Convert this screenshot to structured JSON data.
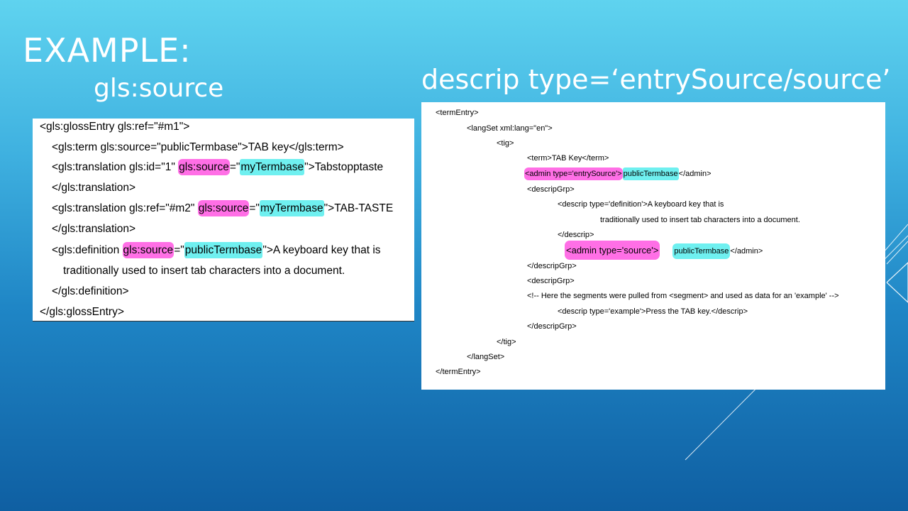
{
  "slide": {
    "title": "EXAMPLE:",
    "left_subtitle": "gls:source",
    "right_subtitle": "descrip type=‘entrySource/source’"
  },
  "left_code": {
    "l1": "<gls:glossEntry gls:ref=\"#m1\">",
    "l2": "<gls:term gls:source=\"publicTermbase\">TAB key</gls:term>",
    "l3a": "<gls:translation gls:id=\"1\" ",
    "l3b": "gls:source",
    "l3c": "=\"",
    "l3d": "myTermbase",
    "l3e": "\">Tabstopptaste",
    "l4": "</gls:translation>",
    "l5a": "<gls:translation gls:ref=\"#m2\" ",
    "l5b": "gls:source",
    "l5c": "=\"",
    "l5d": "myTermbase",
    "l5e": "\">TAB-TASTE",
    "l6": "</gls:translation>",
    "l7a": "<gls:definition ",
    "l7b": "gls:source",
    "l7c": "=\"",
    "l7d": "publicTermbase",
    "l7e": "\">A keyboard key that is",
    "l8": "traditionally used to insert tab characters into a document.",
    "l9": "</gls:definition>",
    "l10": "</gls:glossEntry>"
  },
  "right_code": {
    "r1": "<termEntry>",
    "r2": "<langSet xml:lang=\"en\">",
    "r3": "<tig>",
    "r4": "<term>TAB Key</term>",
    "r5a": "<admin type='entrySource'>",
    "r5b": "publicTermbase",
    "r5c": "</admin>",
    "r6": "<descripGrp>",
    "r7": "<descrip type='definition'>A keyboard key that is",
    "r8": "traditionally used to insert tab characters into a document.",
    "r9": "</descrip>",
    "r10a": "<admin type='source'>",
    "r10b": "publicTermbase",
    "r10c": "</admin>",
    "r11": "</descripGrp>",
    "r12": "<descripGrp>",
    "r13": "<!-- Here the segments were pulled from <segment> and used as data for an 'example' -->",
    "r14": "<descrip type='example'>Press the TAB key.</descrip>",
    "r15": "</descripGrp>",
    "r16": "</tig>",
    "r17": "</langSet>",
    "r18": "</termEntry>"
  },
  "colors": {
    "highlight_pink": "#ff6fe6",
    "highlight_cyan": "#6ff0f0",
    "bg_top": "#5fd3ef",
    "bg_bottom": "#0f5fa2"
  }
}
